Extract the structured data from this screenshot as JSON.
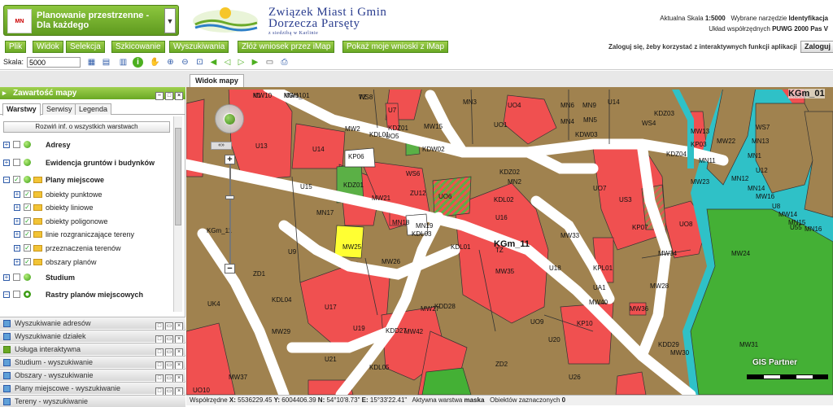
{
  "header": {
    "app_title": "Planowanie przestrzenne - Dla każdego",
    "app_logo_text": "MN",
    "brand_line1": "Związek Miast i Gmin",
    "brand_line2": "Dorzecza Parsęty",
    "brand_line3": "z siedzibą w Karlinie",
    "scale_label": "Aktualna Skala",
    "scale_value": "1:5000",
    "tool_label": "Wybrane narzędzie",
    "tool_value": "Identyfikacja",
    "crs_label": "Układ współrzędnych",
    "crs_value": "PUWG 2000 Pas V"
  },
  "menu": {
    "items": [
      "Plik",
      "Widok",
      "Selekcja",
      "Szkicowanie",
      "Wyszukiwania",
      "Złóż wniosek przez iMap",
      "Pokaż moje wnioski z iMap"
    ],
    "login_text": "Zaloguj się, żeby korzystać z interaktywnych funkcji aplikacji",
    "login_button": "Zaloguj"
  },
  "toolbar": {
    "scale_label": "Skala:",
    "scale_value": "5000"
  },
  "left_panel": {
    "title": "Zawartość mapy",
    "tabs": [
      "Warstwy",
      "Serwisy",
      "Legenda"
    ],
    "expand_all": "Rozwiń inf. o wszystkich warstwach",
    "layers": [
      {
        "label": "Adresy"
      },
      {
        "label": "Ewidencja gruntów i budynków"
      },
      {
        "label": "Plany miejscowe"
      },
      {
        "label": "obiekty punktowe"
      },
      {
        "label": "obiekty liniowe"
      },
      {
        "label": "obiekty poligonowe"
      },
      {
        "label": "linie rozgraniczające tereny"
      },
      {
        "label": "przeznaczenia terenów"
      },
      {
        "label": "obszary planów"
      },
      {
        "label": "Studium"
      },
      {
        "label": "Rastry planów miejscowych"
      }
    ],
    "collapsed_panels": [
      "Wyszukiwanie adresów",
      "Wyszukiwanie działek",
      "Usługa interaktywna",
      "Studium - wyszukiwanie",
      "Obszary - wyszukiwanie",
      "Plany miejscowe - wyszukiwanie",
      "Tereny - wyszukiwanie"
    ]
  },
  "map": {
    "tab_label": "Widok mapy",
    "gis_logo": "GIS Partner",
    "colors": {
      "mw": "#a0824f",
      "u": "#f05050",
      "zu": "#5bb046",
      "zd": "#44b035",
      "water": "#2fc1c7",
      "road": "#ffffff",
      "kp": "#ffffff",
      "kpl": "#ffff33"
    },
    "labels": [
      "MW10",
      "MW11",
      "TZ",
      "U7",
      "MN3",
      "UO4",
      "MN6",
      "MN9",
      "U14",
      "MW2",
      "KDZ01",
      "U13",
      "U14",
      "KP06",
      "MW15",
      "UO5",
      "UO1",
      "MN4",
      "MN5",
      "KDZ03",
      "KDW03",
      "WS4",
      "MW13",
      "WS7",
      "MN1",
      "MW22",
      "KDZ04",
      "KP03",
      "MN13",
      "KDL01",
      "KDW02",
      "U12",
      "MN12",
      "MN11",
      "KDZ02",
      "MN2",
      "MN14",
      "WS6",
      "U15",
      "KDZ01",
      "MW21",
      "ZU12",
      "UO6",
      "KDL02",
      "UO7",
      "US3",
      "MW23",
      "MW16",
      "U8",
      "MW14",
      "MN15",
      "MN16",
      "MN17",
      "MN18",
      "MN19",
      "KDL03",
      "U16",
      "TZ",
      "KP07",
      "UO8",
      "KGm_11",
      "MW25",
      "U9",
      "KDL01",
      "MW33",
      "KPL01",
      "MW34",
      "MW24",
      "MW26",
      "U18",
      "UA1",
      "ZD1",
      "MW35",
      "MW27",
      "MW28",
      "KDL04",
      "U17",
      "UK4",
      "KDD28",
      "MW40",
      "MW36",
      "MW29",
      "U19",
      "KDD27",
      "MW42",
      "UO9",
      "KP10",
      "KDD29",
      "U20",
      "MW30",
      "MW31",
      "U21",
      "KDL05",
      "ZD2",
      "U26",
      "UO10",
      "MW37",
      "KDL04",
      "U55",
      "K1",
      "KGm_01",
      "WS8"
    ],
    "zone_label_main": "KGm_11",
    "zone_label_corner": "KGm_01"
  },
  "status": {
    "coords_label": "Współrzędne",
    "x_label": "X:",
    "x_value": "5536229.45",
    "y_label": "Y:",
    "y_value": "6004406.39",
    "n_label": "N:",
    "n_value": "54°10'8.73\"",
    "e_label": "E:",
    "e_value": "15°33'22.41\"",
    "active_layer_label": "Aktywna warstwa",
    "active_layer_value": "maska",
    "selected_label": "Obiektów zaznaczonych",
    "selected_value": "0"
  }
}
